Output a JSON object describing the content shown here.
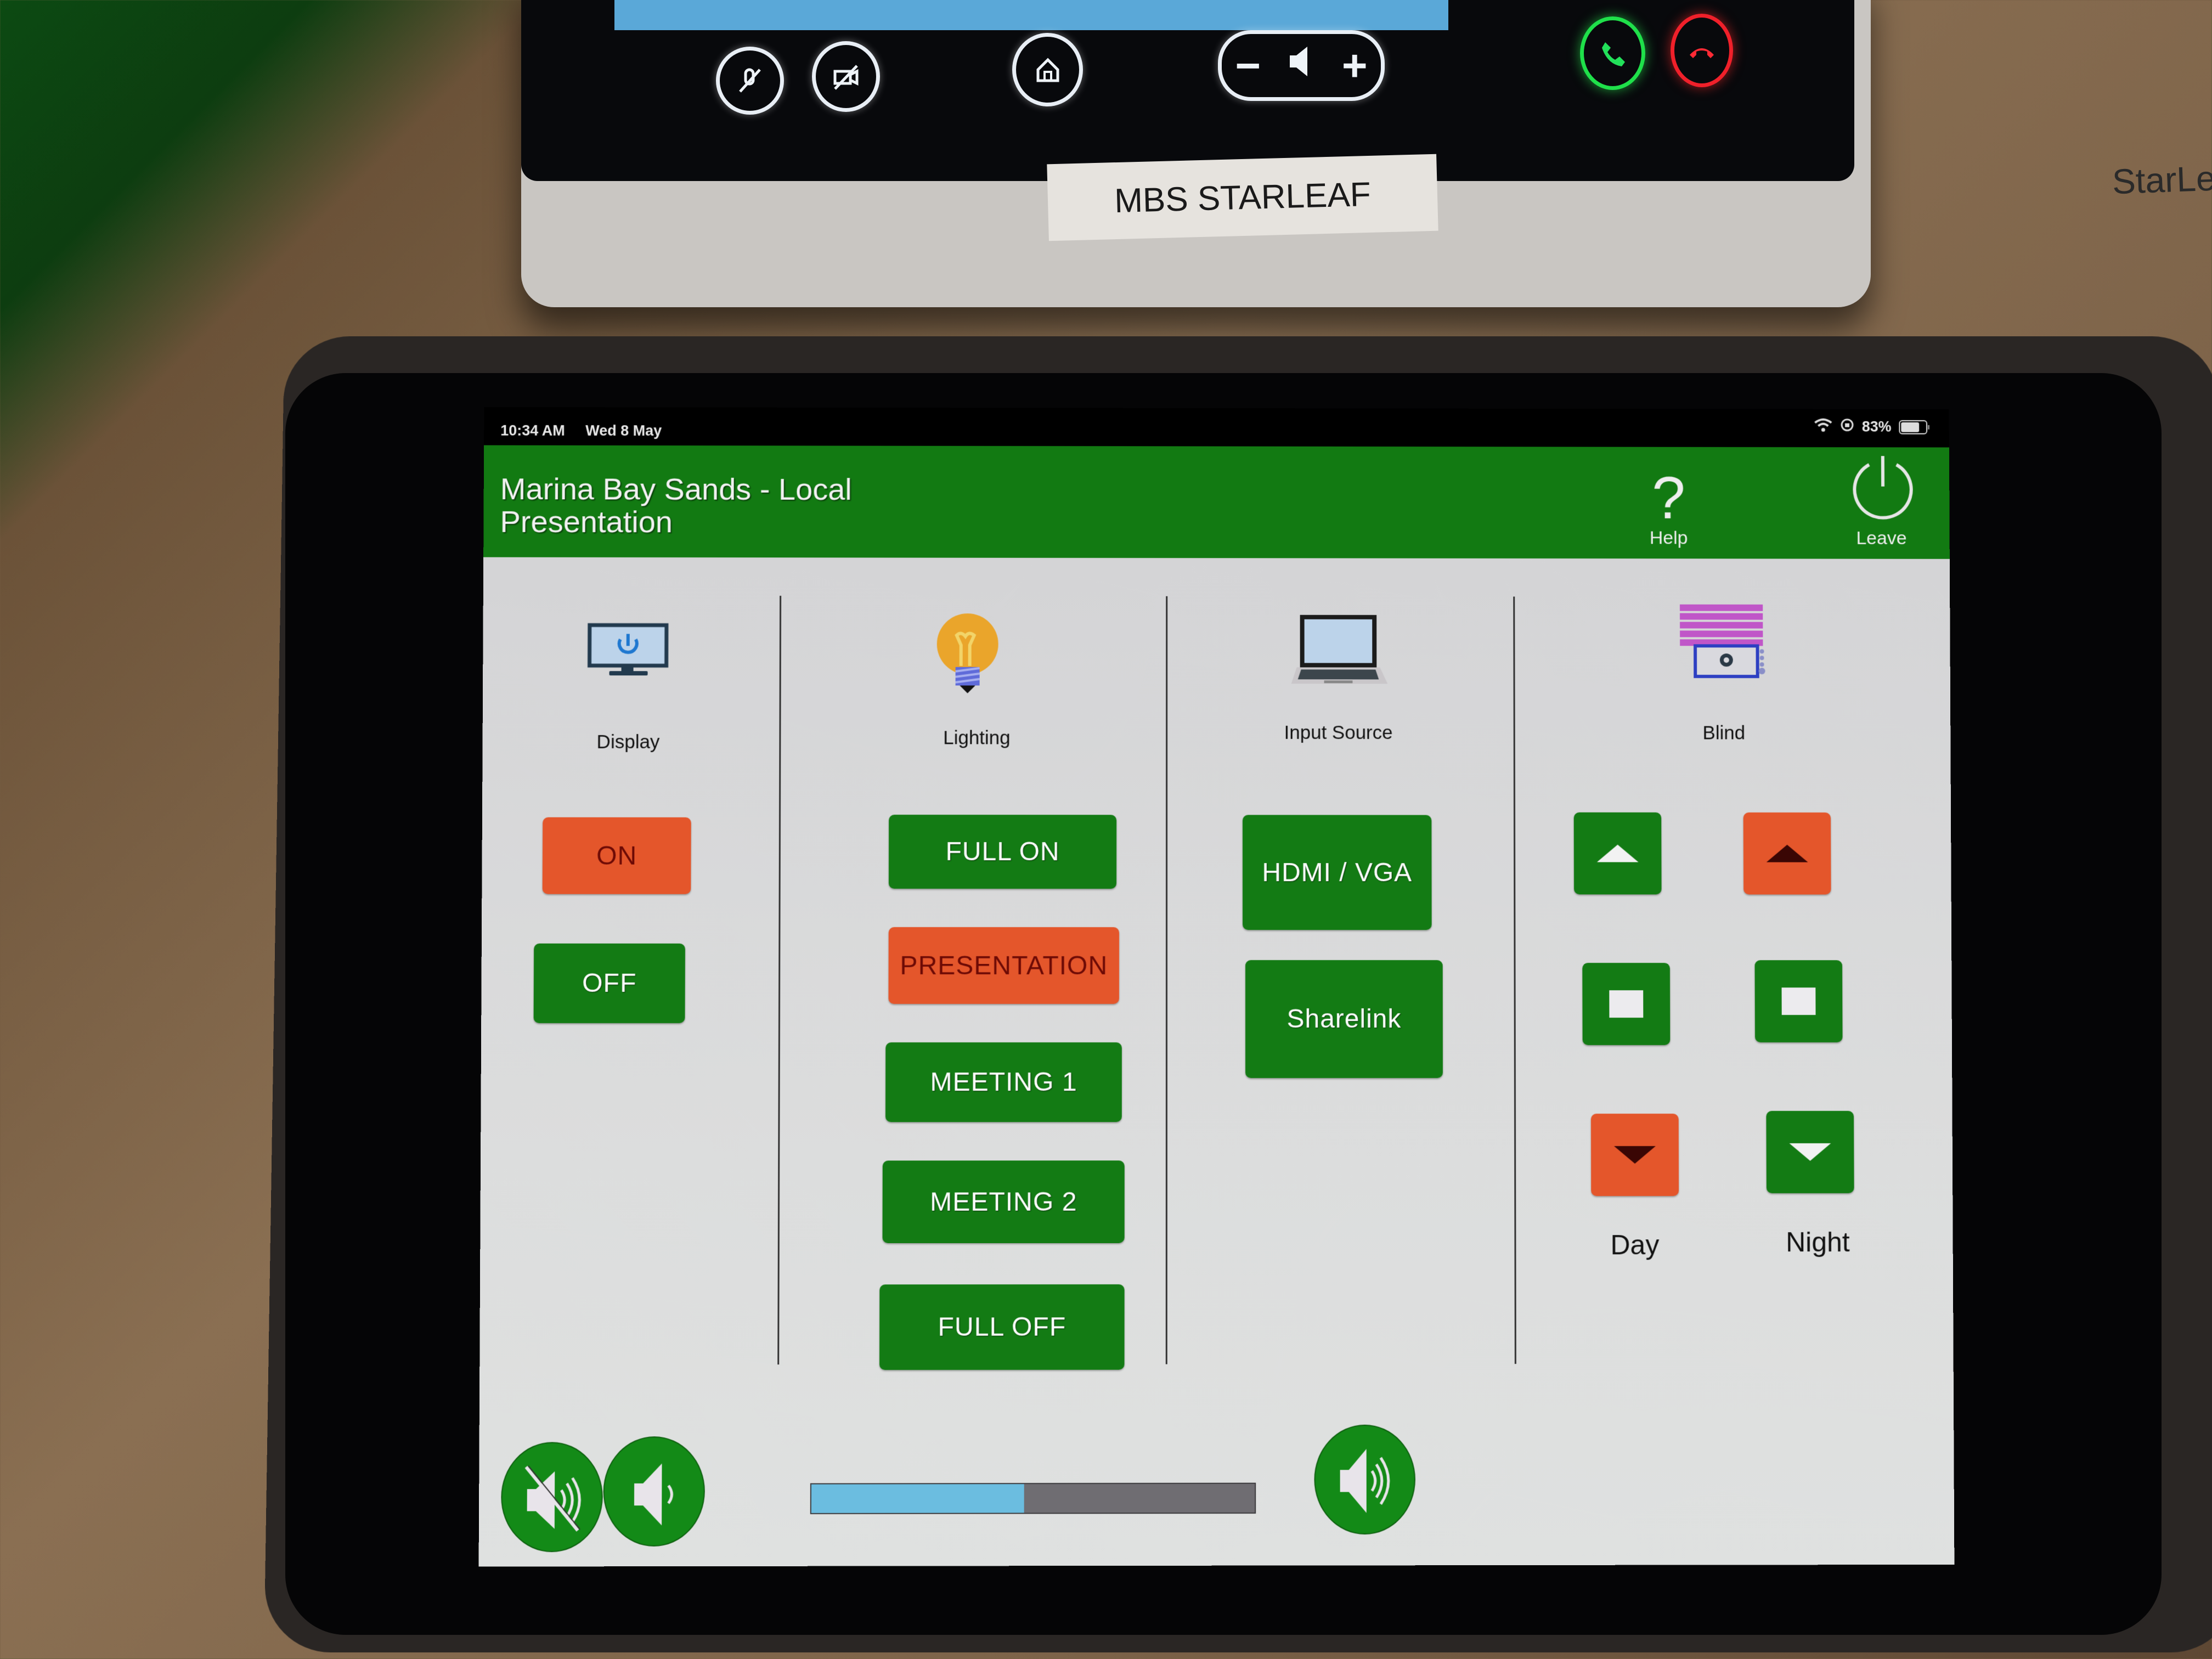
{
  "starleaf_device": {
    "label": "MBS STARLEAF",
    "brand": "StarLeaf",
    "buttons": [
      "mic-mute",
      "camera-off",
      "home",
      "volume-down",
      "volume-up",
      "answer-call",
      "end-call"
    ],
    "volume_minus": "−",
    "volume_plus": "+"
  },
  "status_bar": {
    "time": "10:34 AM",
    "date": "Wed 8 May",
    "battery": "83%",
    "battery_level": 0.83
  },
  "header": {
    "title_line1": "Marina Bay Sands - Local",
    "title_line2": "Presentation",
    "help_glyph": "?",
    "help_label": "Help",
    "leave_label": "Leave"
  },
  "columns": {
    "display": {
      "label": "Display",
      "buttons": [
        {
          "label": "ON",
          "state": "active"
        },
        {
          "label": "OFF",
          "state": "inactive"
        }
      ]
    },
    "lighting": {
      "label": "Lighting",
      "buttons": [
        {
          "label": "FULL ON",
          "state": "inactive"
        },
        {
          "label": "PRESENTATION",
          "state": "active"
        },
        {
          "label": "MEETING 1",
          "state": "inactive"
        },
        {
          "label": "MEETING 2",
          "state": "inactive"
        },
        {
          "label": "FULL OFF",
          "state": "inactive"
        }
      ]
    },
    "input_source": {
      "label": "Input Source",
      "buttons": [
        {
          "label": "HDMI / VGA",
          "state": "inactive"
        },
        {
          "label": "Sharelink",
          "state": "inactive"
        }
      ]
    },
    "blind": {
      "label": "Blind",
      "day_label": "Day",
      "night_label": "Night",
      "day": {
        "up": "inactive",
        "stop": "inactive",
        "down": "active"
      },
      "night": {
        "up": "active",
        "stop": "inactive",
        "down": "inactive"
      }
    }
  },
  "audio": {
    "mute_icon": "speaker-mute-icon",
    "vol_down_icon": "speaker-low-icon",
    "vol_up_icon": "speaker-high-icon",
    "volume_level": 0.48
  },
  "colors": {
    "header_green": "#127a12",
    "button_green": "#137b14",
    "active_orange": "#e4562b",
    "active_text": "#6d0a05",
    "volume_fill": "#6bbde0",
    "volume_track": "#6f6d72"
  }
}
